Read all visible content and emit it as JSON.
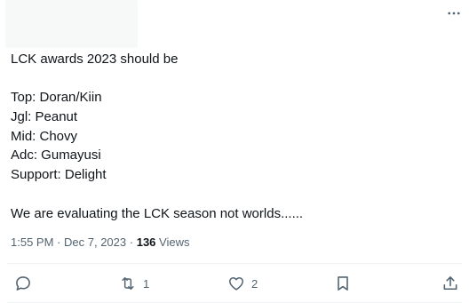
{
  "tweet": {
    "more_label": "…",
    "lines": [
      "LCK awards 2023 should be",
      "",
      "Top: Doran/Kiin",
      "Jgl: Peanut",
      "Mid: Chovy",
      "Adc: Gumayusi",
      "Support: Delight",
      "",
      "We are evaluating the LCK season not worlds......"
    ],
    "time": "1:55 PM",
    "separator": "·",
    "date": "Dec 7, 2023",
    "views_count": "136",
    "views_label": "Views"
  },
  "actions": {
    "reply": {
      "icon": "reply-icon",
      "count": ""
    },
    "retweet": {
      "icon": "retweet-icon",
      "count": "1"
    },
    "like": {
      "icon": "heart-icon",
      "count": "2"
    },
    "bookmark": {
      "icon": "bookmark-icon",
      "count": ""
    },
    "share": {
      "icon": "share-icon",
      "count": ""
    }
  },
  "colors": {
    "text": "#0f1419",
    "secondary": "#536471",
    "divider": "#eff3f4"
  }
}
